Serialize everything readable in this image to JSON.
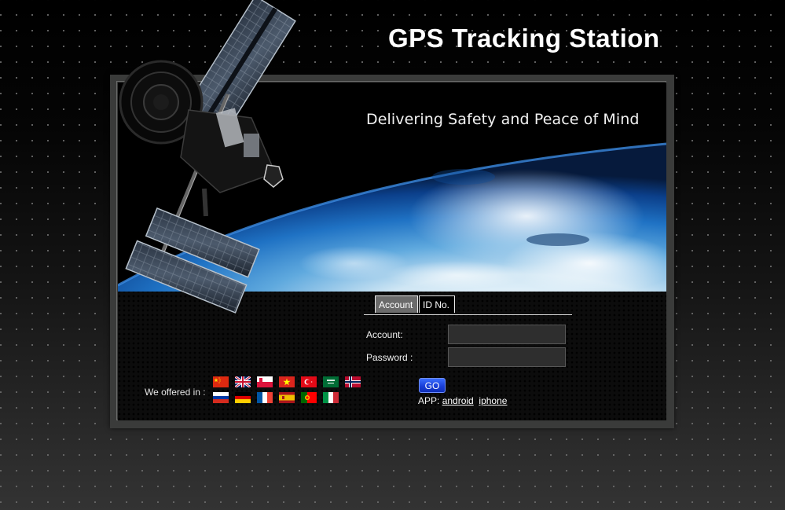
{
  "header": {
    "title": "GPS Tracking Station"
  },
  "banner": {
    "tagline": "Delivering Safety and Peace of Mind"
  },
  "login": {
    "tabs": [
      {
        "label": "Account",
        "active": true
      },
      {
        "label": "ID No.",
        "active": false
      }
    ],
    "account_label": "Account:",
    "account_value": "",
    "password_label": "Password :",
    "password_value": "",
    "go_label": "GO",
    "app_prefix": "APP:",
    "app_links": [
      {
        "label": "android"
      },
      {
        "label": "iphone"
      }
    ]
  },
  "languages": {
    "label": "We offered in :",
    "flags": [
      {
        "country": "china"
      },
      {
        "country": "united-kingdom"
      },
      {
        "country": "poland"
      },
      {
        "country": "vietnam"
      },
      {
        "country": "turkey"
      },
      {
        "country": "saudi-arabia"
      },
      {
        "country": "norway"
      },
      {
        "country": "russia"
      },
      {
        "country": "germany"
      },
      {
        "country": "france"
      },
      {
        "country": "spain"
      },
      {
        "country": "portugal"
      },
      {
        "country": "italy"
      }
    ]
  },
  "colors": {
    "go_button": "#1a3fd8",
    "active_tab": "#6b6b6b",
    "frame": "#3a3b3a"
  }
}
